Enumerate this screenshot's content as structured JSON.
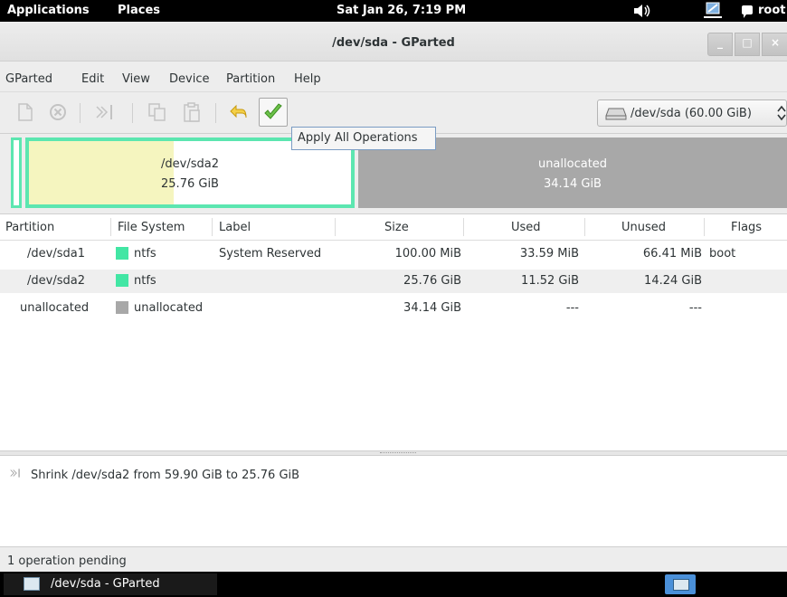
{
  "top_panel": {
    "applications": "Applications",
    "places": "Places",
    "clock": "Sat Jan 26,  7:19 PM",
    "user": "root"
  },
  "window": {
    "title": "/dev/sda - GParted",
    "min_glyph": "_",
    "max_glyph": "□",
    "close_glyph": "×"
  },
  "menubar": {
    "gparted": "GParted",
    "edit": "Edit",
    "view": "View",
    "device": "Device",
    "partition": "Partition",
    "help": "Help"
  },
  "toolbar": {
    "device_selector": "/dev/sda  (60.00 GiB)",
    "tooltip": "Apply All Operations"
  },
  "partition_map": {
    "sda2_name": "/dev/sda2",
    "sda2_size": "25.76 GiB",
    "unalloc_name": "unallocated",
    "unalloc_size": "34.14 GiB"
  },
  "table": {
    "headers": [
      "Partition",
      "File System",
      "Label",
      "Size",
      "Used",
      "Unused",
      "Flags"
    ],
    "rows": [
      {
        "partition": "/dev/sda1",
        "fs": "ntfs",
        "label": "System Reserved",
        "size": "100.00 MiB",
        "used": "33.59 MiB",
        "unused": "66.41 MiB",
        "flags": "boot",
        "fs_color": "#42e6a4"
      },
      {
        "partition": "/dev/sda2",
        "fs": "ntfs",
        "label": "",
        "size": "25.76 GiB",
        "used": "11.52 GiB",
        "unused": "14.24 GiB",
        "flags": "",
        "fs_color": "#42e6a4"
      },
      {
        "partition": "unallocated",
        "fs": "unallocated",
        "label": "",
        "size": "34.14 GiB",
        "used": "---",
        "unused": "---",
        "flags": "",
        "fs_color": "#a8a8a8"
      }
    ]
  },
  "operations": {
    "items": [
      "Shrink /dev/sda2 from 59.90 GiB to 25.76 GiB"
    ]
  },
  "status": {
    "text": "1 operation pending"
  },
  "taskbar": {
    "window_title": "/dev/sda - GParted"
  }
}
